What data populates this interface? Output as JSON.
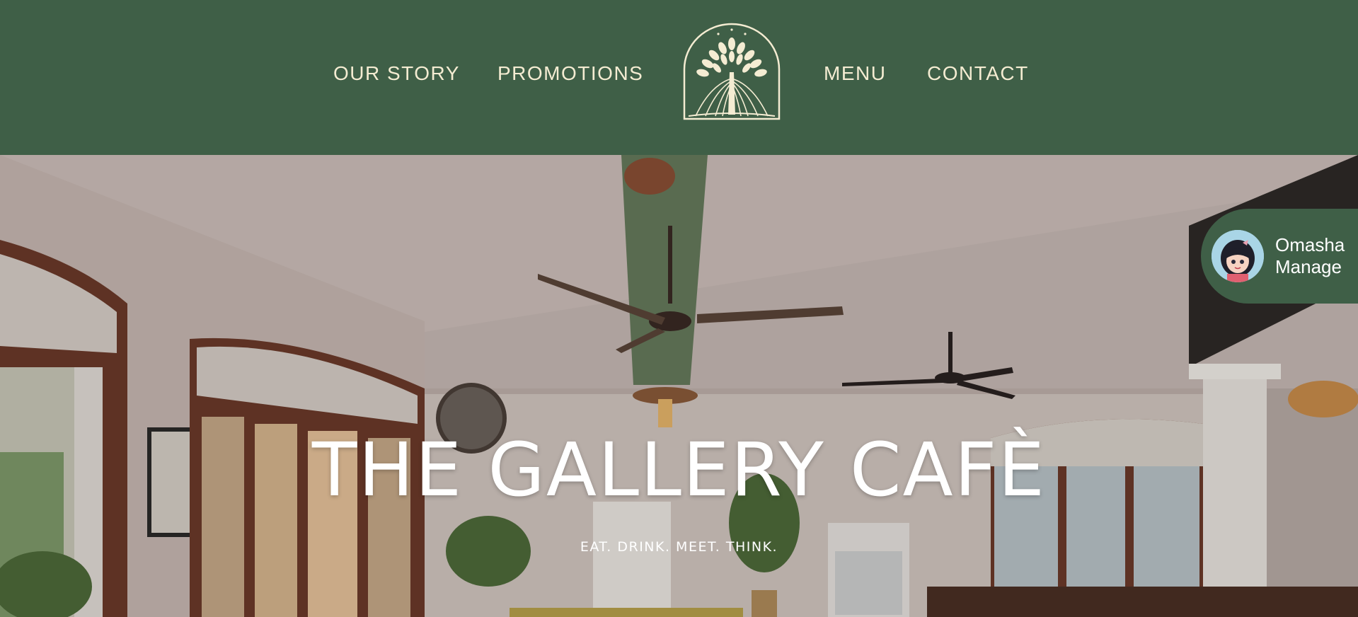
{
  "nav": {
    "left_items": [
      "OUR STORY",
      "PROMOTIONS"
    ],
    "right_items": [
      "MENU",
      "CONTACT"
    ],
    "logo_icon": "tree-logo-icon"
  },
  "hero": {
    "title": "THE GALLERY CAFÈ",
    "subtitle": "EAT. DRINK. MEET. THINK."
  },
  "chat_widget": {
    "line1": "Omasha",
    "line2": "Manage",
    "avatar_icon": "avatar-icon"
  },
  "colors": {
    "header_bg": "#3f5f47",
    "nav_text": "#f4ecd2",
    "hero_text": "#ffffff"
  }
}
